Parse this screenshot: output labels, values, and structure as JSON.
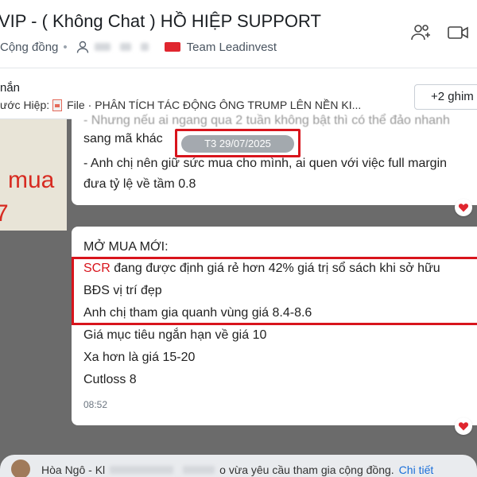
{
  "header": {
    "title": "VIP - ( Không Chat ) HỒ HIỆP SUPPORT",
    "community": "Cộng đồng",
    "team": "Team Leadinvest"
  },
  "pinned": {
    "label": "nắn",
    "sender": "ước Hiệp:",
    "file_prefix": "File ·",
    "file_name": "PHÂN TÍCH TÁC ĐỘNG ÔNG TRUMP LÊN NỀN KI...",
    "more_button": "+2 ghim"
  },
  "left_preview": {
    "text1": "mua",
    "text2": "7"
  },
  "date_separator": "T3 29/07/2025",
  "message1": {
    "line0": "- Nhưng nếu ai ngang qua 2 tuần không bật thì có thể đảo nhanh",
    "line1": "sang mã khác",
    "line2": "- Anh chị nên giữ sức mua cho mình, ai quen với việc full margin",
    "line3": "đưa tỷ lệ về tầm 0.8"
  },
  "message2": {
    "heading": "MỞ MUA MỚI:",
    "ticker": "SCR",
    "line1_rest": " đang được định giá rẻ hơn 42% giá trị sổ sách khi sở hữu",
    "line2": "BĐS vị trí đẹp",
    "line3": "Anh chị tham gia quanh vùng giá 8.4-8.6",
    "line4": "Giá mục tiêu ngắn hạn về giá 10",
    "line5": "Xa hơn là giá 15-20",
    "line6": "Cutloss 8",
    "time": "08:52"
  },
  "notification": {
    "name": "Hòa Ngô - Kl",
    "text": "o vừa yêu cầu tham gia cộng đồng.",
    "link": "Chi tiết"
  },
  "colors": {
    "highlight_red": "#d8141c",
    "link_blue": "#1a6fd9",
    "heart_red": "#e0262f"
  }
}
